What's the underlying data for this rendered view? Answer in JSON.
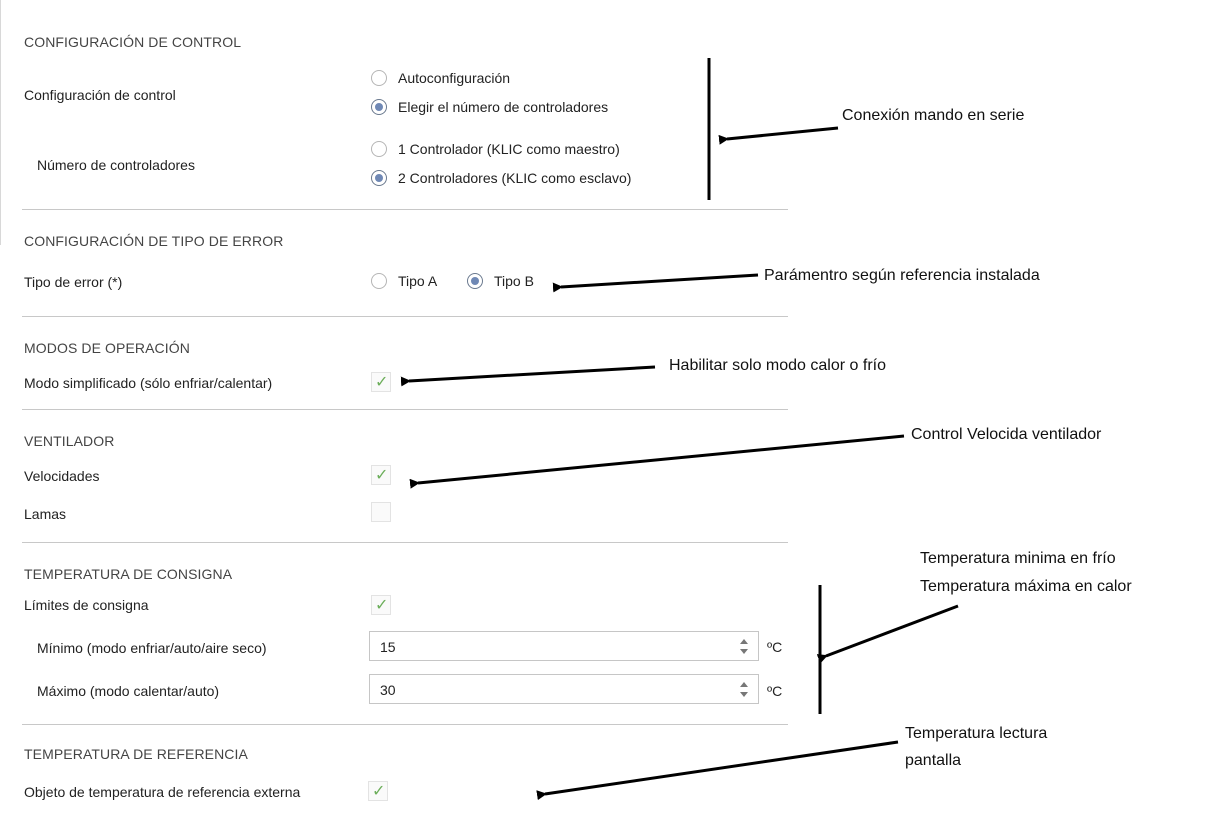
{
  "sections": {
    "control": {
      "title": "CONFIGURACIÓN DE CONTROL",
      "config_label": "Configuración de control",
      "config_options": [
        "Autoconfiguración",
        "Elegir el número de controladores"
      ],
      "config_selected": "Elegir el número de controladores",
      "number_label": "Número de controladores",
      "number_options": [
        "1 Controlador (KLIC como maestro)",
        "2 Controladores (KLIC como esclavo)"
      ],
      "number_selected": "2 Controladores (KLIC como esclavo)"
    },
    "error_type": {
      "title": "CONFIGURACIÓN DE TIPO DE ERROR",
      "label": "Tipo de error (*)",
      "options": [
        "Tipo A",
        "Tipo B"
      ],
      "selected": "Tipo B"
    },
    "operation_modes": {
      "title": "MODOS DE OPERACIÓN",
      "simplified_label": "Modo simplificado (sólo enfriar/calentar)",
      "simplified_checked": true
    },
    "fan": {
      "title": "VENTILADOR",
      "speeds_label": "Velocidades",
      "speeds_checked": true,
      "louvers_label": "Lamas",
      "louvers_checked": false
    },
    "setpoint": {
      "title": "TEMPERATURA DE CONSIGNA",
      "limits_label": "Límites de consigna",
      "limits_checked": true,
      "min_label": "Mínimo (modo enfriar/auto/aire seco)",
      "min_value": "15",
      "max_label": "Máximo (modo calentar/auto)",
      "max_value": "30",
      "unit": "ºC"
    },
    "reference": {
      "title": "TEMPERATURA DE REFERENCIA",
      "external_label": "Objeto de temperatura de referencia externa",
      "external_checked": true
    }
  },
  "annotations": {
    "serial": "Conexión mando en serie",
    "parameter": "Parámentro según referencia instalada",
    "mode": "Habilitar solo modo calor o frío",
    "fan_speed": "Control Velocida ventilador",
    "temp_min": "Temperatura minima en frío",
    "temp_max": "Temperatura máxima en calor",
    "reading_line1": "Temperatura lectura",
    "reading_line2": "pantalla"
  },
  "icons": {
    "check": "check-icon",
    "spin_up": "spin-up-icon",
    "spin_down": "spin-down-icon"
  },
  "colors": {
    "radio_selected": "#6f88b5",
    "check": "#6cae5a",
    "divider": "#c8c8c8"
  }
}
